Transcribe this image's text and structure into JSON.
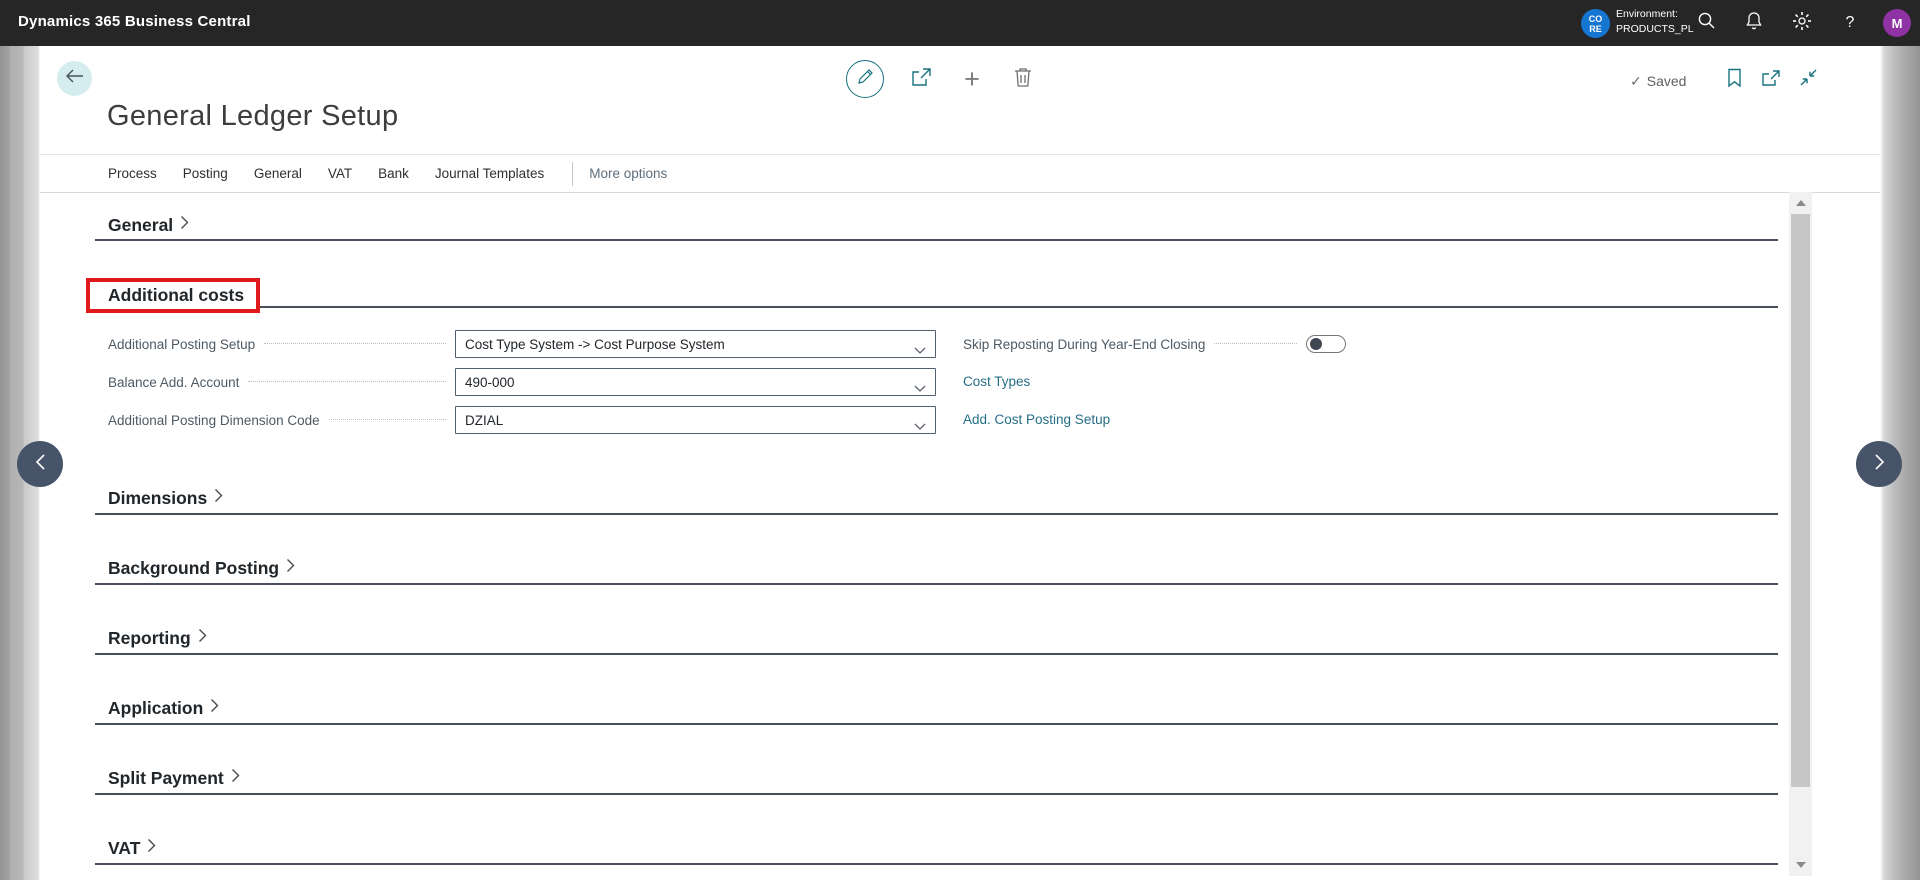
{
  "topbar": {
    "brand": "Dynamics 365 Business Central",
    "environment_label": "Environment:",
    "environment_name": "PRODUCTS_PL",
    "env_badge_line1": "CO",
    "env_badge_line2": "RE",
    "help_glyph": "?",
    "avatar_initial": "M"
  },
  "action_bar": {
    "saved_check_glyph": "✓",
    "saved_label": "Saved",
    "add_glyph": "+"
  },
  "page_title": "General Ledger Setup",
  "menu_tabs": {
    "tabs": [
      "Process",
      "Posting",
      "General",
      "VAT",
      "Bank",
      "Journal Templates"
    ],
    "more_options": "More options"
  },
  "sections": {
    "general_label": "General",
    "additional_costs": {
      "label": "Additional costs",
      "fields": [
        {
          "label": "Additional Posting Setup",
          "value": "Cost Type System -> Cost Purpose System"
        },
        {
          "label": "Balance Add. Account",
          "value": "490-000"
        },
        {
          "label": "Additional Posting Dimension Code",
          "value": "DZIAL"
        }
      ],
      "toggle": {
        "label": "Skip Reposting During Year-End Closing",
        "state": "off"
      },
      "links": [
        {
          "label": "Cost Types"
        },
        {
          "label": "Add. Cost Posting Setup"
        }
      ]
    },
    "collapsed": [
      {
        "label": "Dimensions"
      },
      {
        "label": "Background Posting"
      },
      {
        "label": "Reporting"
      },
      {
        "label": "Application"
      },
      {
        "label": "Split Payment"
      },
      {
        "label": "VAT"
      }
    ]
  },
  "colors": {
    "topbar_bg": "#262626",
    "accent_teal": "#17727d",
    "link": "#266e86",
    "env_badge_bg": "#1476d1",
    "avatar_bg": "#8f32a3",
    "annotation_red": "#e0191c",
    "section_divider": "#47505c",
    "field_border": "#525f6e"
  }
}
